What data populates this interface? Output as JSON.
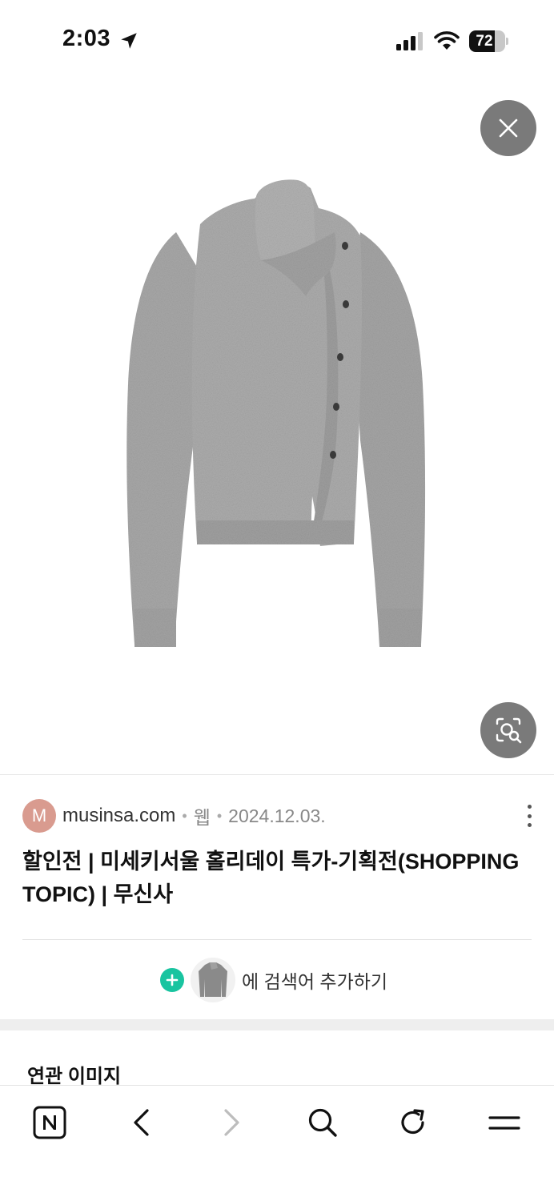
{
  "status_bar": {
    "time": "2:03",
    "battery": "72",
    "battery_level": 0.72,
    "icons": [
      "location-arrow-icon",
      "signal-icon",
      "wifi-icon",
      "battery-icon"
    ]
  },
  "viewer": {
    "close_icon": "close-icon",
    "lens_icon": "image-search-icon",
    "image_subject": "gray knit sweater"
  },
  "result": {
    "favicon_letter": "M",
    "domain": "musinsa.com",
    "separator": "•",
    "type": "웹",
    "date": "2024.12.03.",
    "title": "할인전 | 미세키서울 홀리데이 특가-기획전(SHOPPING TOPIC) | 무신사",
    "more_icon": "more-vertical-icon"
  },
  "add_keyword": {
    "text": "에 검색어 추가하기",
    "icon": "plus-icon"
  },
  "related": {
    "title": "연관 이미지"
  },
  "toolbar": {
    "items": [
      "naver-home-icon",
      "back-icon",
      "forward-icon",
      "search-icon",
      "refresh-icon",
      "menu-icon"
    ]
  },
  "colors": {
    "accent_green": "#19c4a0",
    "overlay_button": "#7a7a7a",
    "favicon": "#d99b8f",
    "sweater": "#a9a9a9"
  }
}
